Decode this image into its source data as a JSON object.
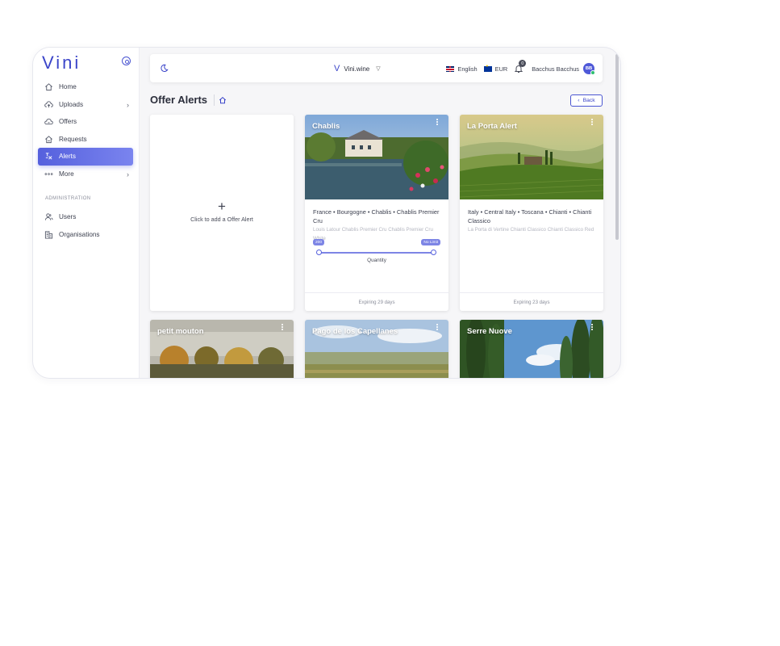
{
  "app": {
    "logo": "Vini"
  },
  "sidebar": {
    "items": [
      {
        "label": "Home",
        "icon": "home-icon"
      },
      {
        "label": "Uploads",
        "icon": "cloud-upload-icon",
        "has_submenu": true
      },
      {
        "label": "Offers",
        "icon": "cloud-offers-icon"
      },
      {
        "label": "Requests",
        "icon": "requests-icon"
      },
      {
        "label": "Alerts",
        "icon": "alerts-icon",
        "active": true
      },
      {
        "label": "More",
        "icon": "more-dots-icon",
        "has_submenu": true
      }
    ],
    "section_label": "ADMINISTRATION",
    "admin_items": [
      {
        "label": "Users",
        "icon": "users-icon"
      },
      {
        "label": "Organisations",
        "icon": "organisations-icon"
      }
    ]
  },
  "topbar": {
    "brand": "Vini.wine",
    "language": "English",
    "currency": "EUR",
    "notification_count": "0",
    "user_name": "Bacchus Bacchus",
    "user_initials": "BB"
  },
  "page": {
    "title": "Offer Alerts",
    "back_label": "Back"
  },
  "add_card": {
    "plus": "+",
    "label": "Click to add a Offer Alert"
  },
  "alerts": [
    {
      "name": "Chablis",
      "region": "France • Bourgogne • Chablis • Chablis Premier Cru",
      "detail": "Louis Latour Chablis Premier Cru Chablis Premier Cru White",
      "quantity_min_label": "200",
      "quantity_max_label": "No Limit",
      "quantity_label": "Quantity",
      "expiry": "Expiring 29 days"
    },
    {
      "name": "La Porta Alert",
      "region": "Italy • Central Italy • Toscana • Chianti • Chianti Classico",
      "detail": "La Porta di Vertine Chianti Classico Chianti Classico Red",
      "expiry": "Expiring 23 days"
    },
    {
      "name": "petit mouton"
    },
    {
      "name": "Pago de los Capellanes"
    },
    {
      "name": "Serre Nuove"
    }
  ],
  "colors": {
    "accent": "#4a55d1",
    "active_nav_start": "#5560dd",
    "active_nav_end": "#7a84ef"
  }
}
